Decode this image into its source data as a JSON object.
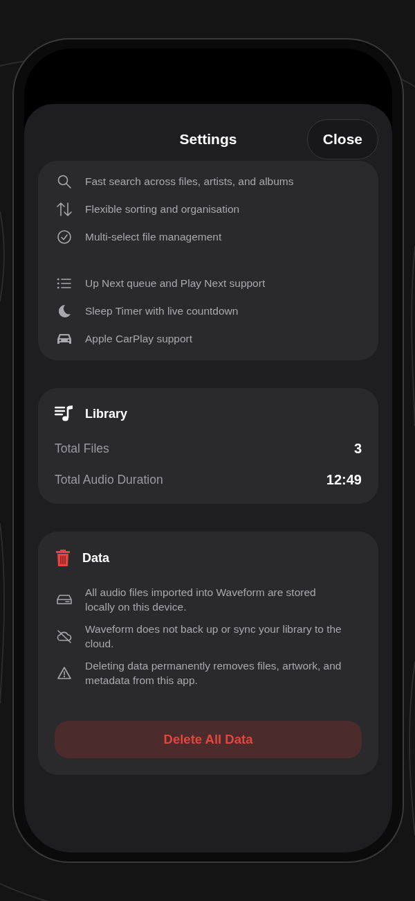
{
  "header": {
    "title": "Settings",
    "close_button": "Close"
  },
  "features": {
    "groups": [
      {
        "items": [
          {
            "text": "Fast search across files, artists, and albums"
          },
          {
            "text": "Flexible sorting and organisation"
          },
          {
            "text": "Multi-select file management"
          }
        ]
      },
      {
        "items": [
          {
            "text": "Up Next queue and Play Next support"
          },
          {
            "text": "Sleep Timer with live countdown"
          },
          {
            "text": "Apple CarPlay support"
          }
        ]
      }
    ]
  },
  "library": {
    "title": "Library",
    "rows": [
      {
        "label": "Total Files",
        "value": "3"
      },
      {
        "label": "Total Audio Duration",
        "value": "12:49"
      }
    ]
  },
  "data": {
    "title": "Data",
    "notes": [
      {
        "text": "All audio files imported into Waveform are stored locally on this device."
      },
      {
        "text": "Waveform does not back up or sync your library to the cloud."
      },
      {
        "text": "Deleting data permanently removes files, artwork, and metadata from this app."
      }
    ],
    "delete_button": "Delete All Data"
  }
}
